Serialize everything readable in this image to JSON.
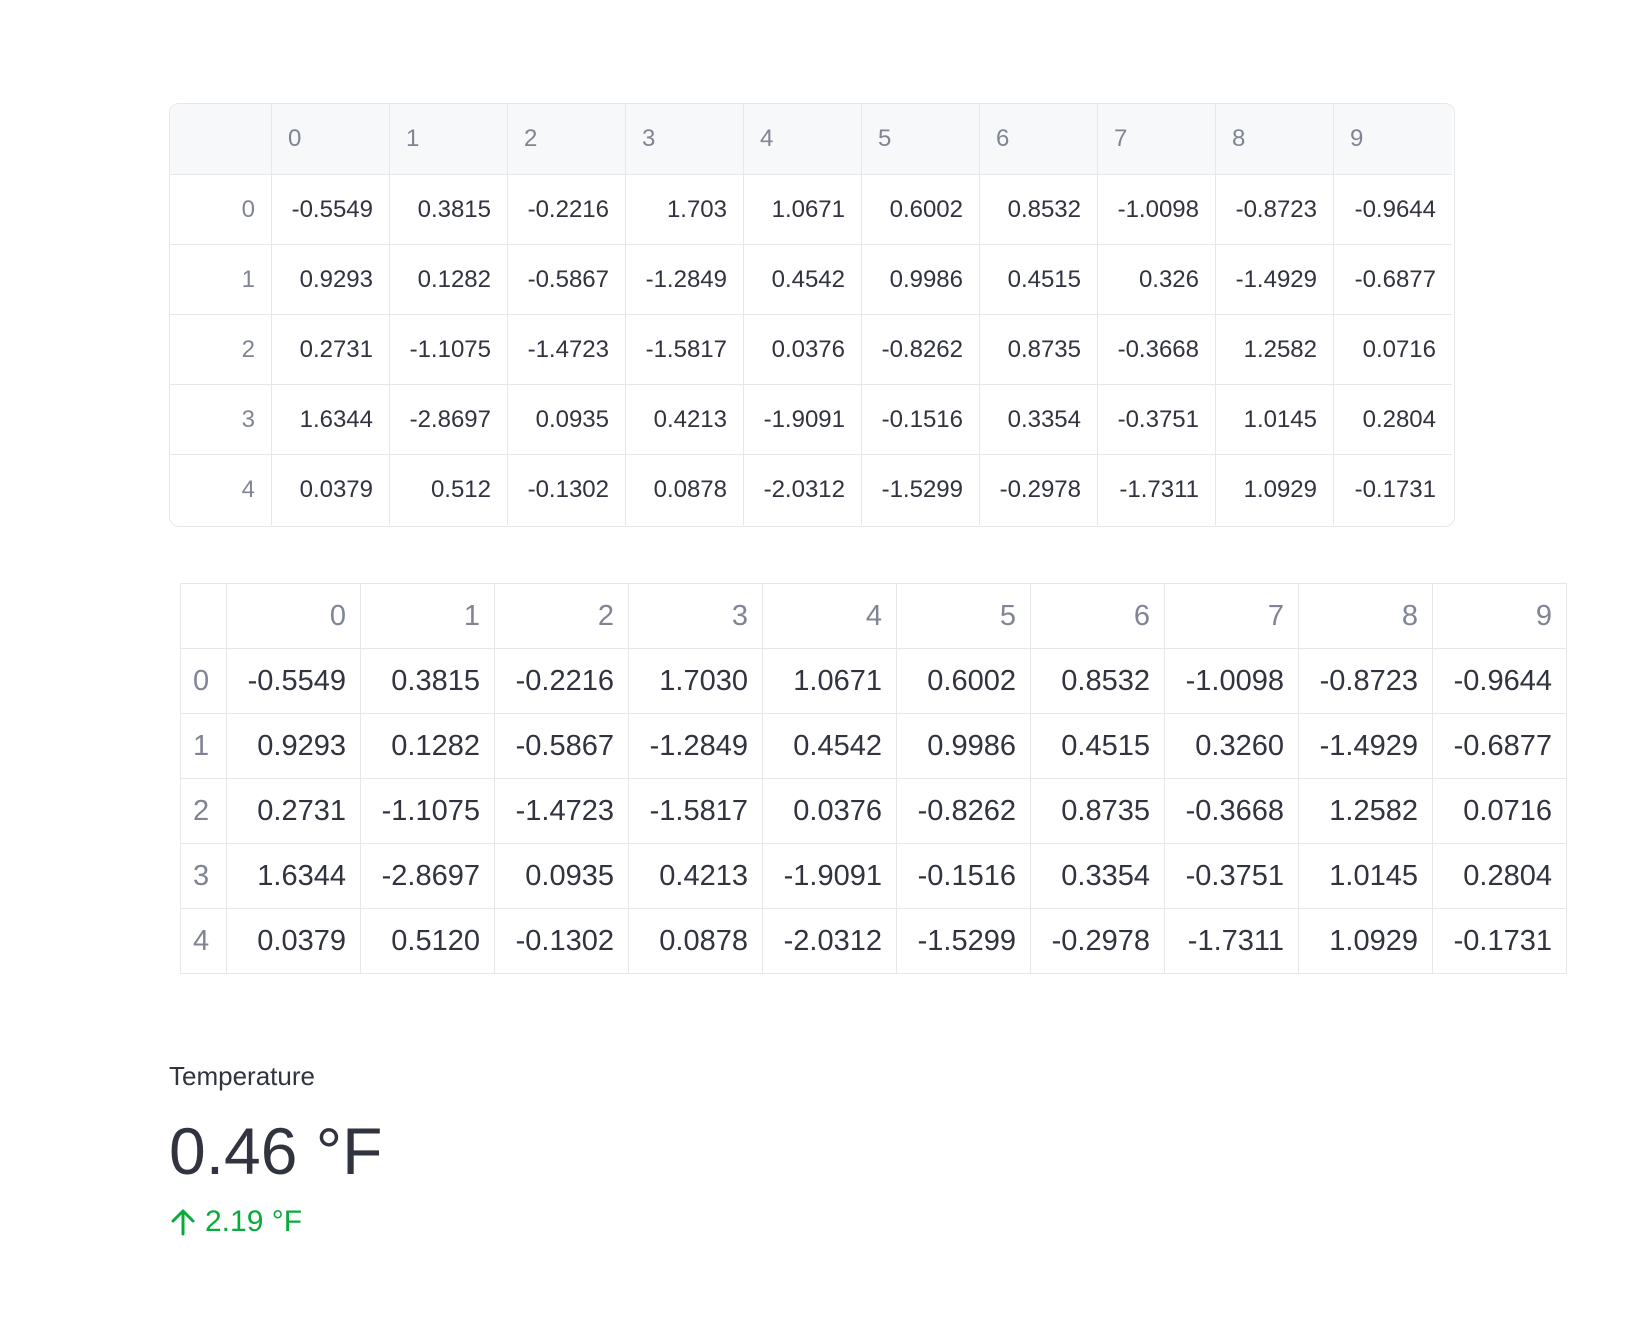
{
  "dataframe": {
    "columns": [
      "0",
      "1",
      "2",
      "3",
      "4",
      "5",
      "6",
      "7",
      "8",
      "9"
    ],
    "index": [
      "0",
      "1",
      "2",
      "3",
      "4"
    ],
    "rows": [
      [
        "-0.5549",
        "0.3815",
        "-0.2216",
        "1.703",
        "1.0671",
        "0.6002",
        "0.8532",
        "-1.0098",
        "-0.8723",
        "-0.9644"
      ],
      [
        "0.9293",
        "0.1282",
        "-0.5867",
        "-1.2849",
        "0.4542",
        "0.9986",
        "0.4515",
        "0.326",
        "-1.4929",
        "-0.6877"
      ],
      [
        "0.2731",
        "-1.1075",
        "-1.4723",
        "-1.5817",
        "0.0376",
        "-0.8262",
        "0.8735",
        "-0.3668",
        "1.2582",
        "0.0716"
      ],
      [
        "1.6344",
        "-2.8697",
        "0.0935",
        "0.4213",
        "-1.9091",
        "-0.1516",
        "0.3354",
        "-0.3751",
        "1.0145",
        "0.2804"
      ],
      [
        "0.0379",
        "0.512",
        "-0.1302",
        "0.0878",
        "-2.0312",
        "-1.5299",
        "-0.2978",
        "-1.7311",
        "1.0929",
        "-0.1731"
      ]
    ]
  },
  "table": {
    "columns": [
      "0",
      "1",
      "2",
      "3",
      "4",
      "5",
      "6",
      "7",
      "8",
      "9"
    ],
    "index": [
      "0",
      "1",
      "2",
      "3",
      "4"
    ],
    "rows": [
      [
        "-0.5549",
        "0.3815",
        "-0.2216",
        "1.7030",
        "1.0671",
        "0.6002",
        "0.8532",
        "-1.0098",
        "-0.8723",
        "-0.9644"
      ],
      [
        "0.9293",
        "0.1282",
        "-0.5867",
        "-1.2849",
        "0.4542",
        "0.9986",
        "0.4515",
        "0.3260",
        "-1.4929",
        "-0.6877"
      ],
      [
        "0.2731",
        "-1.1075",
        "-1.4723",
        "-1.5817",
        "0.0376",
        "-0.8262",
        "0.8735",
        "-0.3668",
        "1.2582",
        "0.0716"
      ],
      [
        "1.6344",
        "-2.8697",
        "0.0935",
        "0.4213",
        "-1.9091",
        "-0.1516",
        "0.3354",
        "-0.3751",
        "1.0145",
        "0.2804"
      ],
      [
        "0.0379",
        "0.5120",
        "-0.1302",
        "0.0878",
        "-2.0312",
        "-1.5299",
        "-0.2978",
        "-1.7311",
        "1.0929",
        "-0.1731"
      ]
    ]
  },
  "metric": {
    "label": "Temperature",
    "value": "0.46 °F",
    "delta": "2.19 °F",
    "delta_direction": "up",
    "delta_icon": "arrow-up-icon",
    "delta_color": "#09ab3b"
  }
}
